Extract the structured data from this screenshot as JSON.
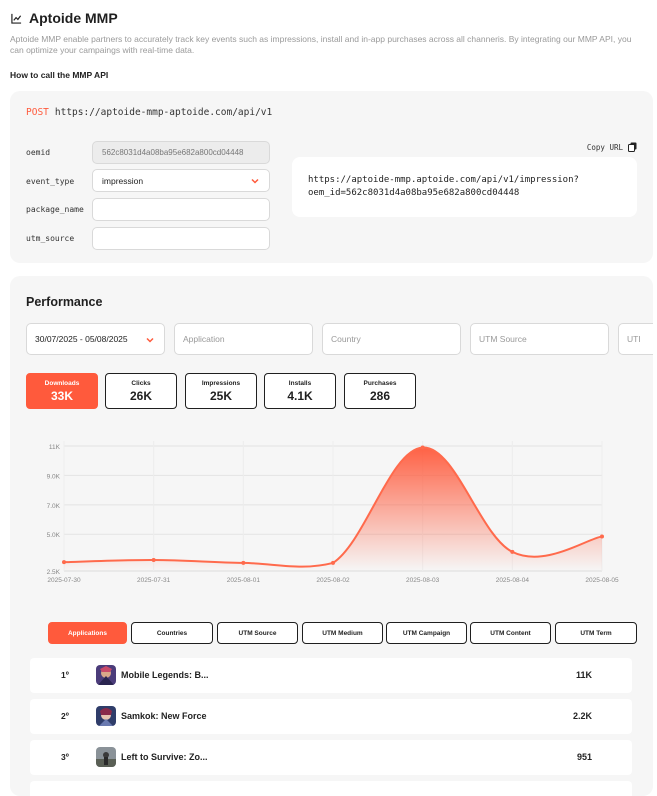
{
  "header": {
    "title": "Aptoide MMP",
    "description": "Aptoide MMP enable partners to accurately track key events such as impressions, install and in-app purchases across all channeris. By integrating our MMP API, you can optimize your campaings with real-time data.",
    "howto": "How to call the MMP API"
  },
  "api": {
    "method": "POST",
    "base_url": "https://aptoide-mmp-aptoide.com/api/v1",
    "fields": {
      "oemid_label": "oemid",
      "oemid_value": "562c8031d4a08ba95e682a800cd04448",
      "event_type_label": "event_type",
      "event_type_value": "impression",
      "package_name_label": "package_name",
      "package_name_value": "",
      "utm_source_label": "utm_source",
      "utm_source_value": ""
    },
    "copy_label": "Copy URL",
    "result_line1": "https://aptoide-mmp.aptoide.com/api/v1/impression?",
    "result_line2": "oem_id=562c8031d4a08ba95e682a800cd04448"
  },
  "performance": {
    "title": "Performance",
    "filters": {
      "date": "30/07/2025 - 05/08/2025",
      "application": "Application",
      "country": "Country",
      "utm_source": "UTM Source",
      "utm_more": "UTI"
    },
    "metrics": [
      {
        "label": "Downloads",
        "value": "33K"
      },
      {
        "label": "Clicks",
        "value": "26K"
      },
      {
        "label": "Impressions",
        "value": "25K"
      },
      {
        "label": "Installs",
        "value": "4.1K"
      },
      {
        "label": "Purchases",
        "value": "286"
      }
    ],
    "tabs": [
      "Applications",
      "Countries",
      "UTM Source",
      "UTM Medium",
      "UTM Campaign",
      "UTM Content",
      "UTM Term"
    ],
    "rows": [
      {
        "rank": "1º",
        "name": "Mobile Legends: B...",
        "value": "11K"
      },
      {
        "rank": "2º",
        "name": "Samkok: New Force",
        "value": "2.2K"
      },
      {
        "rank": "3º",
        "name": "Left to Survive: Zo...",
        "value": "951"
      }
    ]
  },
  "colors": {
    "accent": "#ff5a3c",
    "card_bg": "#f6f6f6",
    "text_dark": "#1f1f1f"
  },
  "chart_data": {
    "type": "area",
    "x": [
      "2025-07-30",
      "2025-07-31",
      "2025-08-01",
      "2025-08-02",
      "2025-08-03",
      "2025-08-04",
      "2025-08-05"
    ],
    "values": [
      3100,
      3250,
      3050,
      3050,
      10900,
      3800,
      4850
    ],
    "y_ticks": [
      2500,
      5000,
      7000,
      9000,
      11000
    ],
    "y_tick_labels": [
      "2.5K",
      "5.0K",
      "7.0K",
      "9.0K",
      "11K"
    ],
    "ylim": [
      2500,
      11000
    ],
    "grid": true,
    "legend": "none"
  }
}
